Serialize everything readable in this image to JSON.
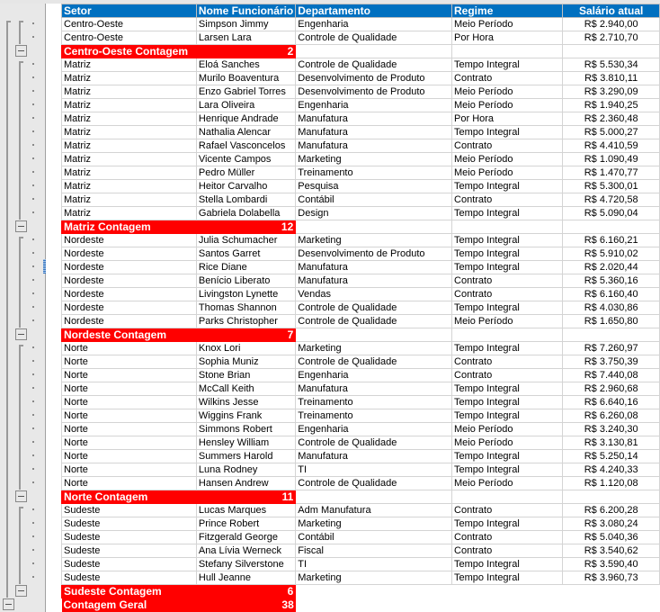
{
  "colors": {
    "header_bg": "#0070c0",
    "group_bg": "#ff0000",
    "grid": "#d4d4d4"
  },
  "columns": [
    "Setor",
    "Nome Funcionário",
    "Departamento",
    "Regime",
    "Salário atual"
  ],
  "groups": [
    {
      "label": "Centro-Oeste Contagem",
      "count": "2",
      "rows": [
        [
          "Centro-Oeste",
          "Simpson Jimmy",
          "Engenharia",
          "Meio Período",
          "R$ 2.940,00"
        ],
        [
          "Centro-Oeste",
          "Larsen Lara",
          "Controle de Qualidade",
          "Por Hora",
          "R$ 2.710,70"
        ]
      ]
    },
    {
      "label": "Matriz Contagem",
      "count": "12",
      "rows": [
        [
          "Matriz",
          "Eloá Sanches",
          "Controle de Qualidade",
          "Tempo Integral",
          "R$ 5.530,34"
        ],
        [
          "Matriz",
          "Murilo Boaventura",
          "Desenvolvimento de Produto",
          "Contrato",
          "R$ 3.810,11"
        ],
        [
          "Matriz",
          "Enzo Gabriel Torres",
          "Desenvolvimento de Produto",
          "Meio Período",
          "R$ 3.290,09"
        ],
        [
          "Matriz",
          "Lara Oliveira",
          "Engenharia",
          "Meio Período",
          "R$ 1.940,25"
        ],
        [
          "Matriz",
          "Henrique Andrade",
          "Manufatura",
          "Por Hora",
          "R$ 2.360,48"
        ],
        [
          "Matriz",
          "Nathalia Alencar",
          "Manufatura",
          "Tempo Integral",
          "R$ 5.000,27"
        ],
        [
          "Matriz",
          "Rafael Vasconcelos",
          "Manufatura",
          "Contrato",
          "R$ 4.410,59"
        ],
        [
          "Matriz",
          "Vicente Campos",
          "Marketing",
          "Meio Período",
          "R$ 1.090,49"
        ],
        [
          "Matriz",
          "Pedro Müller",
          "Treinamento",
          "Meio Período",
          "R$ 1.470,77"
        ],
        [
          "Matriz",
          "Heitor Carvalho",
          "Pesquisa",
          "Tempo Integral",
          "R$ 5.300,01"
        ],
        [
          "Matriz",
          "Stella Lombardi",
          "Contábil",
          "Contrato",
          "R$ 4.720,58"
        ],
        [
          "Matriz",
          "Gabriela Dolabella",
          "Design",
          "Tempo Integral",
          "R$ 5.090,04"
        ]
      ]
    },
    {
      "label": "Nordeste Contagem",
      "count": "7",
      "rows": [
        [
          "Nordeste",
          "Julia Schumacher",
          "Marketing",
          "Tempo Integral",
          "R$ 6.160,21"
        ],
        [
          "Nordeste",
          "Santos Garret",
          "Desenvolvimento de Produto",
          "Tempo Integral",
          "R$ 5.910,02"
        ],
        [
          "Nordeste",
          "Rice Diane",
          "Manufatura",
          "Tempo Integral",
          "R$ 2.020,44"
        ],
        [
          "Nordeste",
          "Benício Liberato",
          "Manufatura",
          "Contrato",
          "R$ 5.360,16"
        ],
        [
          "Nordeste",
          "Livingston Lynette",
          "Vendas",
          "Contrato",
          "R$ 6.160,40"
        ],
        [
          "Nordeste",
          "Thomas Shannon",
          "Controle de Qualidade",
          "Tempo Integral",
          "R$ 4.030,86"
        ],
        [
          "Nordeste",
          "Parks Christopher",
          "Controle de Qualidade",
          "Meio Período",
          "R$ 1.650,80"
        ]
      ]
    },
    {
      "label": "Norte Contagem",
      "count": "11",
      "rows": [
        [
          "Norte",
          "Knox Lori",
          "Marketing",
          "Tempo Integral",
          "R$ 7.260,97"
        ],
        [
          "Norte",
          "Sophia Muniz",
          "Controle de Qualidade",
          "Contrato",
          "R$ 3.750,39"
        ],
        [
          "Norte",
          "Stone Brian",
          "Engenharia",
          "Contrato",
          "R$ 7.440,08"
        ],
        [
          "Norte",
          "McCall Keith",
          "Manufatura",
          "Tempo Integral",
          "R$ 2.960,68"
        ],
        [
          "Norte",
          "Wilkins Jesse",
          "Treinamento",
          "Tempo Integral",
          "R$ 6.640,16"
        ],
        [
          "Norte",
          "Wiggins Frank",
          "Treinamento",
          "Tempo Integral",
          "R$ 6.260,08"
        ],
        [
          "Norte",
          "Simmons Robert",
          "Engenharia",
          "Meio Período",
          "R$ 3.240,30"
        ],
        [
          "Norte",
          "Hensley William",
          "Controle de Qualidade",
          "Meio Período",
          "R$ 3.130,81"
        ],
        [
          "Norte",
          "Summers Harold",
          "Manufatura",
          "Tempo Integral",
          "R$ 5.250,14"
        ],
        [
          "Norte",
          "Luna Rodney",
          "TI",
          "Tempo Integral",
          "R$ 4.240,33"
        ],
        [
          "Norte",
          "Hansen Andrew",
          "Controle de Qualidade",
          "Meio Período",
          "R$ 1.120,08"
        ]
      ]
    },
    {
      "label": "Sudeste Contagem",
      "count": "6",
      "rows": [
        [
          "Sudeste",
          "Lucas Marques",
          "Adm Manufatura",
          "Contrato",
          "R$ 6.200,28"
        ],
        [
          "Sudeste",
          "Prince Robert",
          "Marketing",
          "Tempo Integral",
          "R$ 3.080,24"
        ],
        [
          "Sudeste",
          "Fitzgerald George",
          "Contábil",
          "Contrato",
          "R$ 5.040,36"
        ],
        [
          "Sudeste",
          "Ana Lívia Werneck",
          "Fiscal",
          "Contrato",
          "R$ 3.540,62"
        ],
        [
          "Sudeste",
          "Stefany Silverstone",
          "TI",
          "Tempo Integral",
          "R$ 3.590,40"
        ],
        [
          "Sudeste",
          "Hull Jeanne",
          "Marketing",
          "Tempo Integral",
          "R$ 3.960,73"
        ]
      ]
    }
  ],
  "grand_total": {
    "label": "Contagem Geral",
    "count": "38"
  },
  "outline": {
    "collapse_icon": "minus-box-icon",
    "levels": 2
  }
}
